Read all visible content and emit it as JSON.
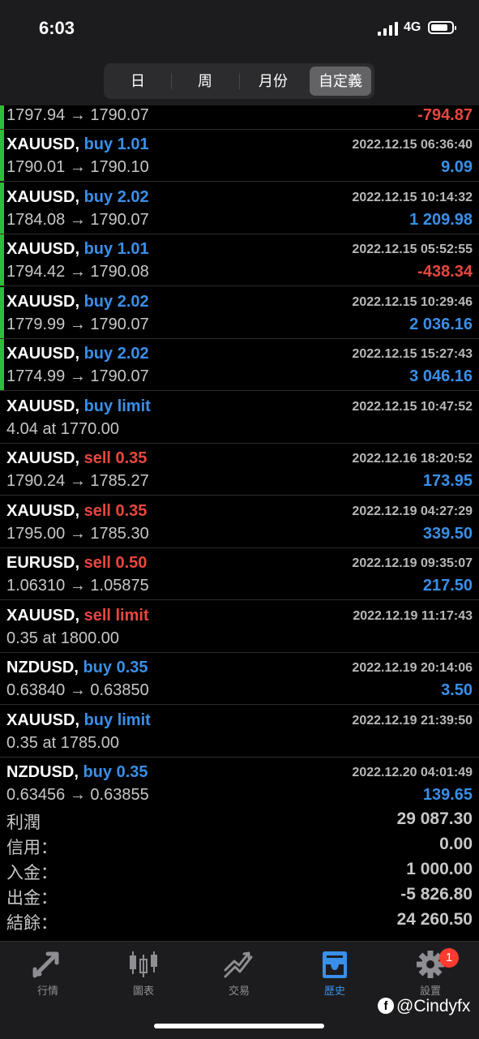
{
  "status_bar": {
    "time": "6:03",
    "network": "4G"
  },
  "period_tabs": [
    {
      "label": "日",
      "active": false
    },
    {
      "label": "周",
      "active": false
    },
    {
      "label": "月份",
      "active": false
    },
    {
      "label": "自定義",
      "active": true
    }
  ],
  "partial_row": {
    "prices": "1797.94 → 1790.07",
    "profit": "-794.87",
    "profit_sign": "neg",
    "open": true
  },
  "trades": [
    {
      "symbol": "XAUUSD,",
      "side": "buy 1.01",
      "side_type": "buy",
      "date": "2022.12.15 06:36:40",
      "prices": "1790.01 → 1790.10",
      "profit": "9.09",
      "profit_sign": "pos",
      "open": true
    },
    {
      "symbol": "XAUUSD,",
      "side": "buy 2.02",
      "side_type": "buy",
      "date": "2022.12.15 10:14:32",
      "prices": "1784.08 → 1790.07",
      "profit": "1 209.98",
      "profit_sign": "pos",
      "open": true
    },
    {
      "symbol": "XAUUSD,",
      "side": "buy 1.01",
      "side_type": "buy",
      "date": "2022.12.15 05:52:55",
      "prices": "1794.42 → 1790.08",
      "profit": "-438.34",
      "profit_sign": "neg",
      "open": true
    },
    {
      "symbol": "XAUUSD,",
      "side": "buy 2.02",
      "side_type": "buy",
      "date": "2022.12.15 10:29:46",
      "prices": "1779.99 → 1790.07",
      "profit": "2 036.16",
      "profit_sign": "pos",
      "open": true
    },
    {
      "symbol": "XAUUSD,",
      "side": "buy 2.02",
      "side_type": "buy",
      "date": "2022.12.15 15:27:43",
      "prices": "1774.99 → 1790.07",
      "profit": "3 046.16",
      "profit_sign": "pos",
      "open": true
    },
    {
      "symbol": "XAUUSD,",
      "side": "buy limit",
      "side_type": "buy",
      "date": "2022.12.15 10:47:52",
      "prices": "4.04 at 1770.00",
      "profit": "",
      "profit_sign": "pos",
      "open": false
    },
    {
      "symbol": "XAUUSD,",
      "side": "sell 0.35",
      "side_type": "sell",
      "date": "2022.12.16 18:20:52",
      "prices": "1790.24 → 1785.27",
      "profit": "173.95",
      "profit_sign": "pos",
      "open": false
    },
    {
      "symbol": "XAUUSD,",
      "side": "sell 0.35",
      "side_type": "sell",
      "date": "2022.12.19 04:27:29",
      "prices": "1795.00 → 1785.30",
      "profit": "339.50",
      "profit_sign": "pos",
      "open": false
    },
    {
      "symbol": "EURUSD,",
      "side": "sell 0.50",
      "side_type": "sell",
      "date": "2022.12.19 09:35:07",
      "prices": "1.06310 → 1.05875",
      "profit": "217.50",
      "profit_sign": "pos",
      "open": false
    },
    {
      "symbol": "XAUUSD,",
      "side": "sell limit",
      "side_type": "sell",
      "date": "2022.12.19 11:17:43",
      "prices": "0.35 at 1800.00",
      "profit": "",
      "profit_sign": "pos",
      "open": false
    },
    {
      "symbol": "NZDUSD,",
      "side": "buy 0.35",
      "side_type": "buy",
      "date": "2022.12.19 20:14:06",
      "prices": "0.63840 → 0.63850",
      "profit": "3.50",
      "profit_sign": "pos",
      "open": false
    },
    {
      "symbol": "XAUUSD,",
      "side": "buy limit",
      "side_type": "buy",
      "date": "2022.12.19 21:39:50",
      "prices": "0.35 at 1785.00",
      "profit": "",
      "profit_sign": "pos",
      "open": false
    },
    {
      "symbol": "NZDUSD,",
      "side": "buy 0.35",
      "side_type": "buy",
      "date": "2022.12.20 04:01:49",
      "prices": "0.63456 → 0.63855",
      "profit": "139.65",
      "profit_sign": "pos",
      "open": false
    }
  ],
  "summary": [
    {
      "label": "利潤",
      "value": "29 087.30"
    },
    {
      "label": "信用：",
      "value": "0.00"
    },
    {
      "label": "入金：",
      "value": "1 000.00"
    },
    {
      "label": "出金：",
      "value": "-5 826.80"
    },
    {
      "label": "結餘：",
      "value": "24 260.50"
    }
  ],
  "tabbar": [
    {
      "label": "行情",
      "icon": "quotes-arrows-icon",
      "active": false
    },
    {
      "label": "圖表",
      "icon": "candlestick-chart-icon",
      "active": false
    },
    {
      "label": "交易",
      "icon": "trade-trend-icon",
      "active": false
    },
    {
      "label": "歷史",
      "icon": "history-inbox-icon",
      "active": true
    },
    {
      "label": "設置",
      "icon": "gear-icon",
      "active": false,
      "badge": "1"
    }
  ],
  "watermark": {
    "handle": "@Cindyfx",
    "icon": "facebook-icon"
  },
  "colors": {
    "buy": "#3a8fe8",
    "sell": "#e8473f",
    "open_position_bar": "#2dbd3c",
    "background": "#000000",
    "bar_background": "#1c1c1e",
    "badge": "#ff3b30"
  }
}
